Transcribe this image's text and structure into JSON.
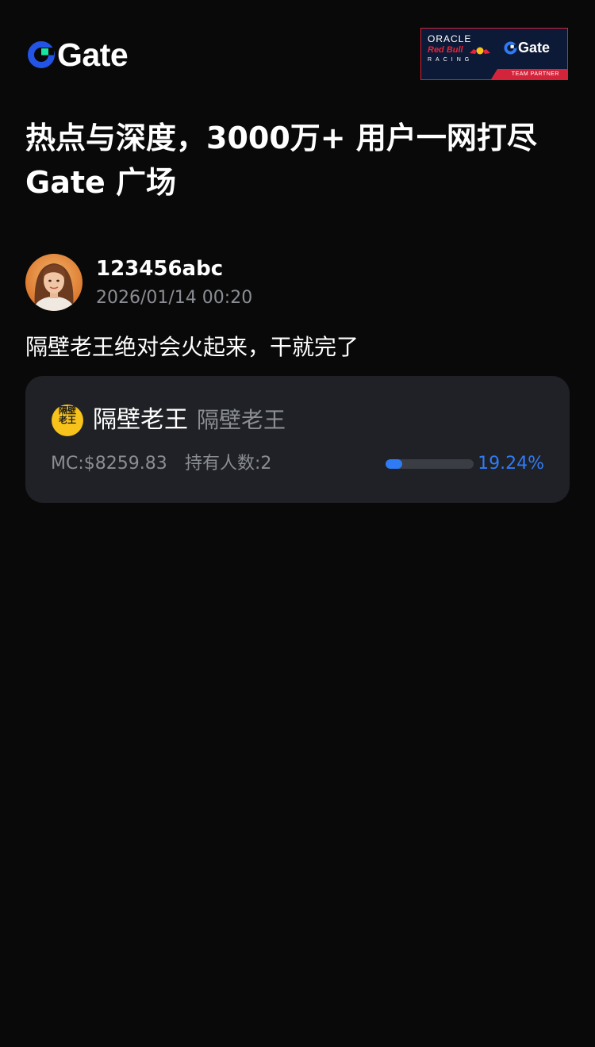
{
  "header": {
    "logo_text": "Gate",
    "partner_badge": {
      "oracle": "ORACLE",
      "redbull": "Red Bull",
      "racing": "RACING",
      "gate": "Gate",
      "caption": "TEAM PARTNER"
    }
  },
  "headline": {
    "line1": "热点与深度，3000万+ 用户一网打尽",
    "line2": "Gate 广场"
  },
  "post": {
    "author": "123456abc",
    "timestamp": "2026/01/14 00:20",
    "text": "隔壁老王绝对会火起来，干就完了"
  },
  "token": {
    "icon_text": "隔壁老王",
    "name": "隔壁老王",
    "symbol": "隔壁老王",
    "market_cap": "MC:$8259.83",
    "holders": "持有人数:2",
    "progress_percent": 19.24,
    "progress_label": "19.24%"
  },
  "colors": {
    "background": "#090909",
    "card": "#1f2126",
    "muted_text": "#8a8d93",
    "accent_blue": "#2f7bf5",
    "gate_green": "#17e6a1",
    "gate_blue": "#2354e6",
    "partner_navy": "#0d1a37",
    "partner_red": "#d4243b",
    "token_yellow": "#f6c21b"
  },
  "icons": {
    "logo": "gate-logo-icon",
    "avatar": "user-avatar",
    "token": "token-icon"
  }
}
